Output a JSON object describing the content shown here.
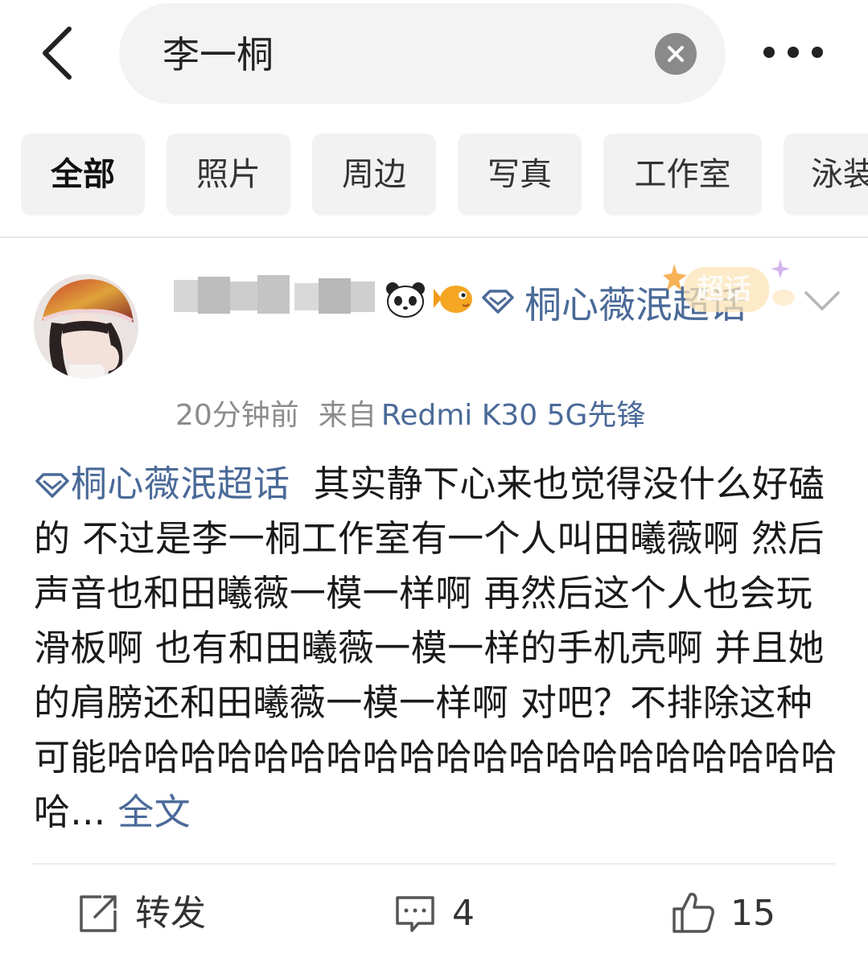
{
  "search": {
    "query": "李一桐"
  },
  "tabs": [
    "全部",
    "照片",
    "周边",
    "写真",
    "工作室",
    "泳装"
  ],
  "post": {
    "topic_name": "桐心薇泯超话",
    "badge_label": "超话",
    "time": "20分钟前",
    "from_label": "来自",
    "device": "Redmi K30 5G先锋",
    "topic_tag": "桐心薇泯超话",
    "text": "其实静下心来也觉得没什么好磕的 不过是李一桐工作室有一个人叫田曦薇啊 然后声音也和田曦薇一模一样啊 再然后这个人也会玩滑板啊 也有和田曦薇一模一样的手机壳啊 并且她的肩膀还和田曦薇一模一样啊 对吧？不排除这种可能哈哈哈哈哈哈哈哈哈哈哈哈哈哈哈哈哈哈哈哈哈...",
    "full_text_link": "全文"
  },
  "actions": {
    "repost_label": "转发",
    "comment_count": "4",
    "like_count": "15"
  },
  "colors": {
    "link": "#4a6a98",
    "meta": "#8c8c8c",
    "tab_bg": "#f2f2f2",
    "search_bg": "#f3f3f3"
  },
  "icons": {
    "back": "chevron-left-icon",
    "clear": "close-circle-icon",
    "more": "more-dots-icon",
    "topic": "diamond-icon",
    "expand": "chevron-down-icon",
    "repost": "share-square-icon",
    "comment": "comment-bubble-icon",
    "like": "thumbs-up-icon"
  }
}
